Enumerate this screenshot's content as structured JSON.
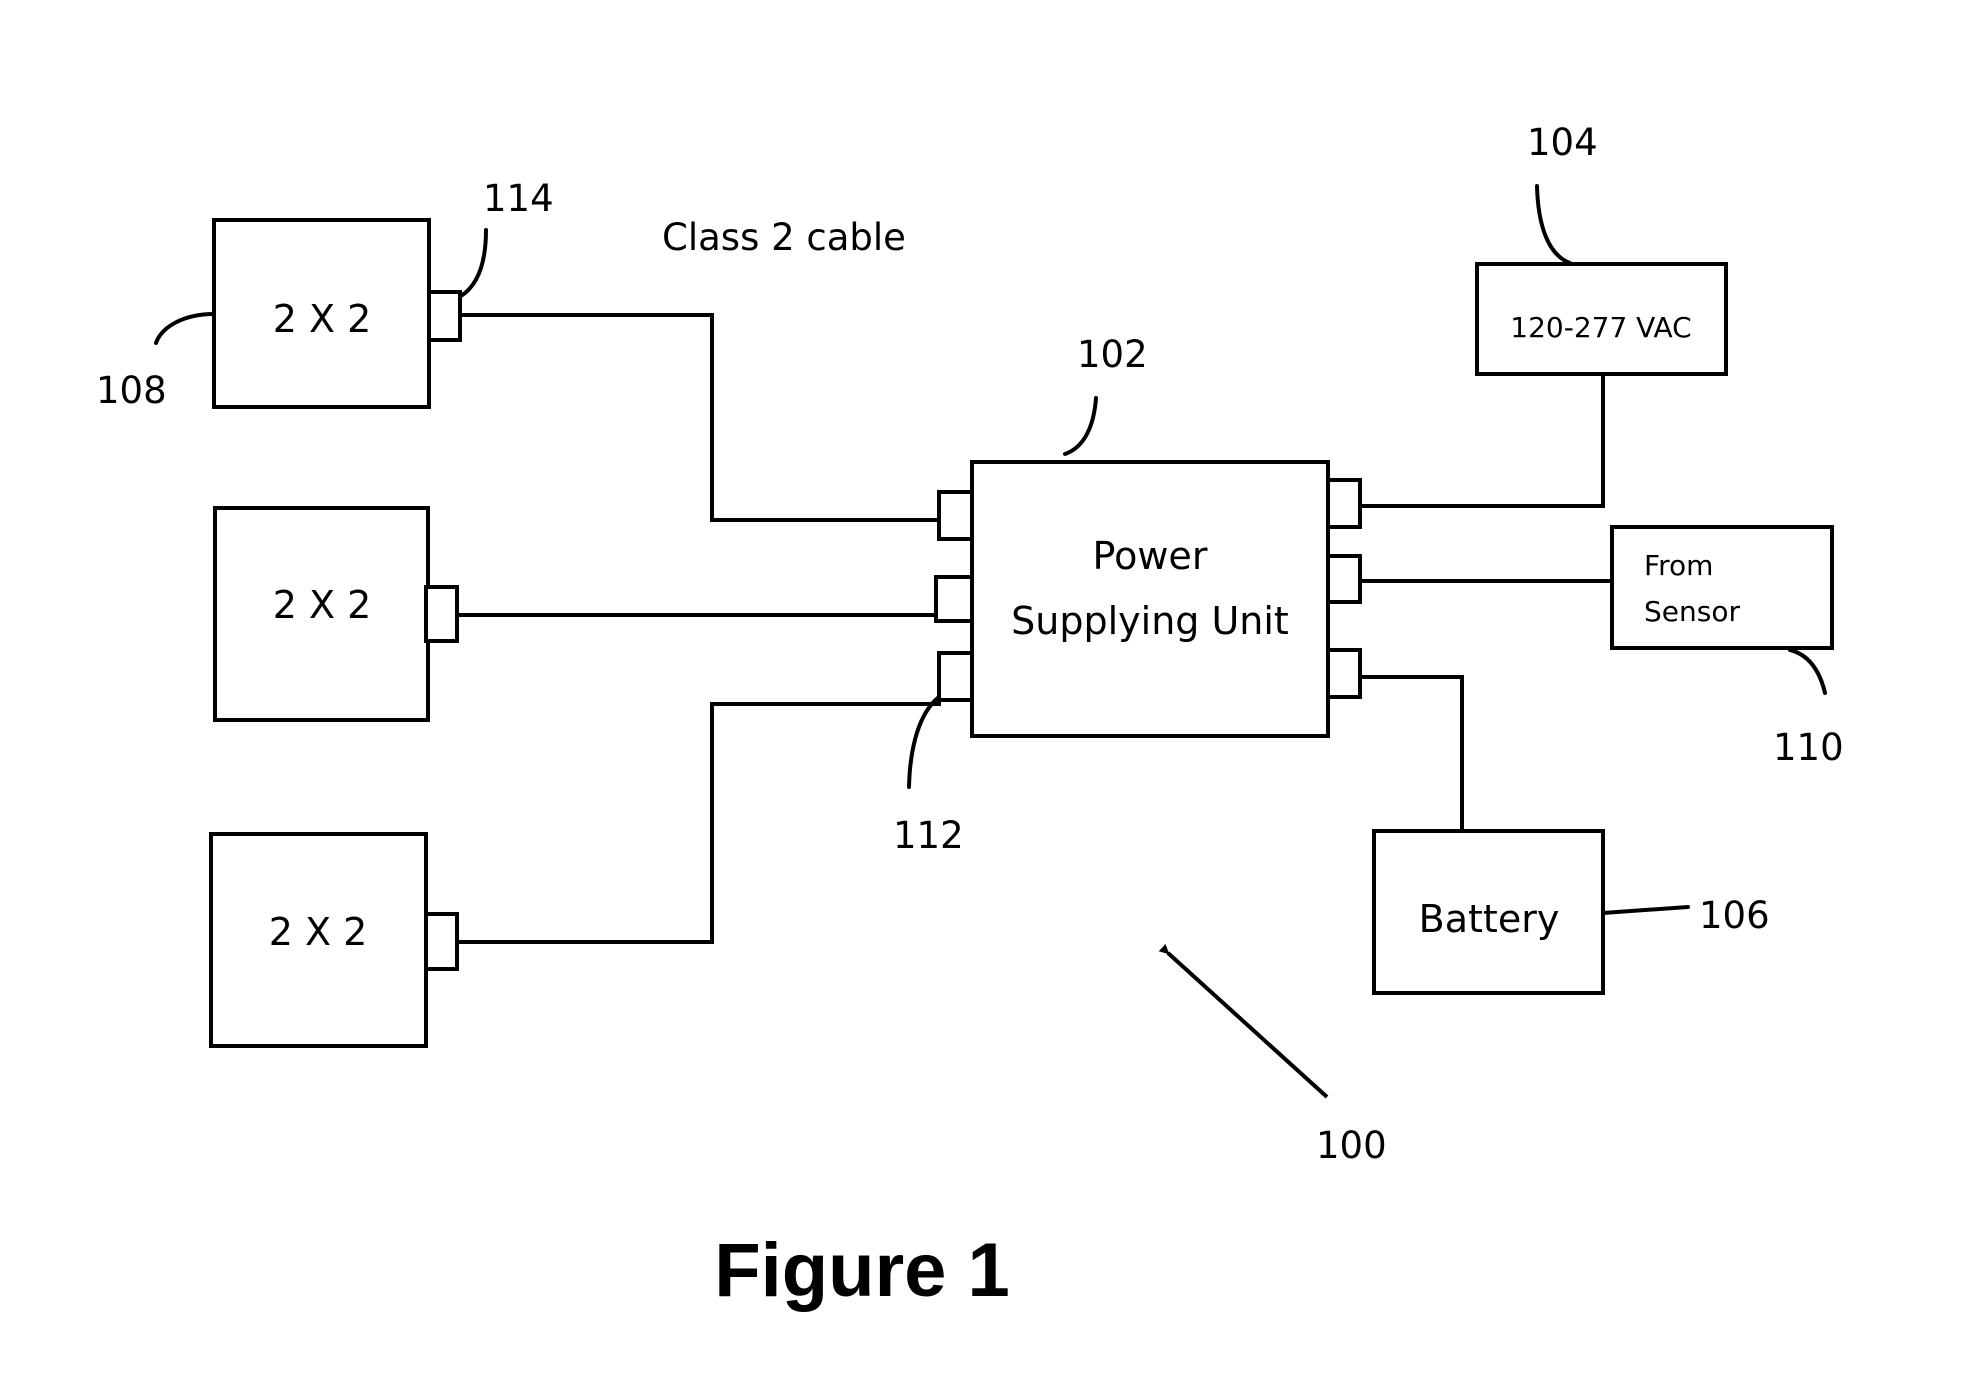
{
  "diagram": {
    "cable_label": "Class 2 cable",
    "figure_caption": "Figure 1",
    "fixtures": [
      {
        "label": "2 X 2",
        "ref": "108"
      },
      {
        "label": "2 X 2"
      },
      {
        "label": "2 X 2"
      }
    ],
    "connector_ref": "114",
    "psu": {
      "line1": "Power",
      "line2": "Supplying Unit",
      "ref": "102",
      "port_ref": "112"
    },
    "ac_source": {
      "label": "120-277 VAC",
      "ref": "104"
    },
    "sensor": {
      "line1": "From",
      "line2": "Sensor",
      "ref": "110"
    },
    "battery": {
      "label": "Battery",
      "ref": "106"
    },
    "system_ref": "100",
    "colors": {
      "stroke": "#000000",
      "background": "#ffffff"
    }
  }
}
